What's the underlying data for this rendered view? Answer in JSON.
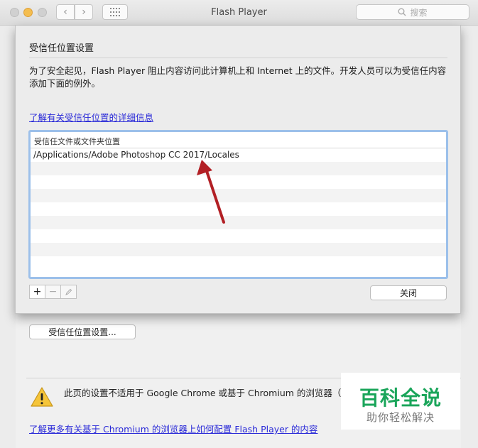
{
  "window": {
    "title": "Flash Player",
    "search_placeholder": "搜索"
  },
  "sheet": {
    "title": "受信任位置设置",
    "description": "为了安全起见，Flash Player 阻止内容访问此计算机上和 Internet 上的文件。开发人员可以为受信任内容添加下面的例外。",
    "info_link": "了解有关受信任位置的详细信息",
    "list": {
      "header": "受信任文件或文件夹位置",
      "items": [
        "/Applications/Adobe Photoshop CC 2017/Locales"
      ]
    },
    "add_label": "+",
    "remove_label": "−",
    "close_label": "关闭",
    "annotation_color": "#b21f24"
  },
  "pane": {
    "trusted_button": "受信任位置设置...",
    "warning_text": "此页的设置不适用于 Google Chrome 或基于 Chromium 的浏览器（",
    "bottom_link": "了解更多有关基于 Chromium 的浏览器上如何配置 Flash Player 的内容"
  },
  "watermark": {
    "title": "百科全说",
    "subtitle": "助你轻松解决"
  }
}
